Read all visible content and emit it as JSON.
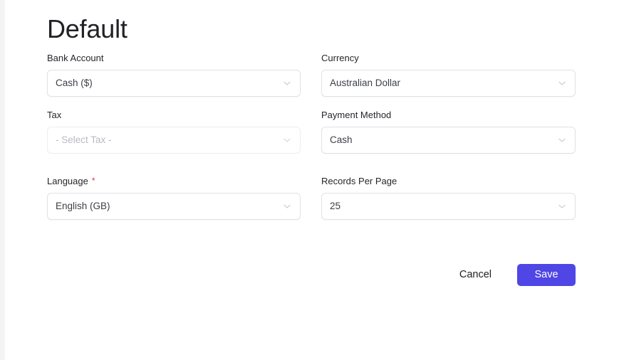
{
  "page": {
    "title": "Default"
  },
  "form": {
    "fields": [
      {
        "key": "bank_account",
        "label": "Bank Account",
        "value": "Cash ($)",
        "required": false,
        "muted": false,
        "icon": "chevron-down-icon"
      },
      {
        "key": "currency",
        "label": "Currency",
        "value": "Australian Dollar",
        "required": false,
        "muted": false,
        "icon": "chevron-down-icon"
      },
      {
        "key": "tax",
        "label": "Tax",
        "value": "- Select Tax -",
        "required": false,
        "muted": true,
        "icon": "chevron-down-icon"
      },
      {
        "key": "payment_method",
        "label": "Payment Method",
        "value": "Cash",
        "required": false,
        "muted": false,
        "icon": "chevron-down-icon"
      },
      {
        "key": "language",
        "label": "Language",
        "required_marker": "*",
        "value": "English (GB)",
        "required": true,
        "muted": false,
        "icon": "chevron-down-icon"
      },
      {
        "key": "records_per_page",
        "label": "Records Per Page",
        "value": "25",
        "required": false,
        "muted": false,
        "icon": "chevron-down-icon"
      }
    ]
  },
  "actions": {
    "cancel_label": "Cancel",
    "save_label": "Save"
  },
  "colors": {
    "accent": "#4f46e5",
    "required_star": "#d23b4b",
    "label_text": "#25262b",
    "value_text": "#3c3f45",
    "placeholder_text": "#b9bbc2",
    "border": "#e2e2e6",
    "background": "#ffffff"
  }
}
